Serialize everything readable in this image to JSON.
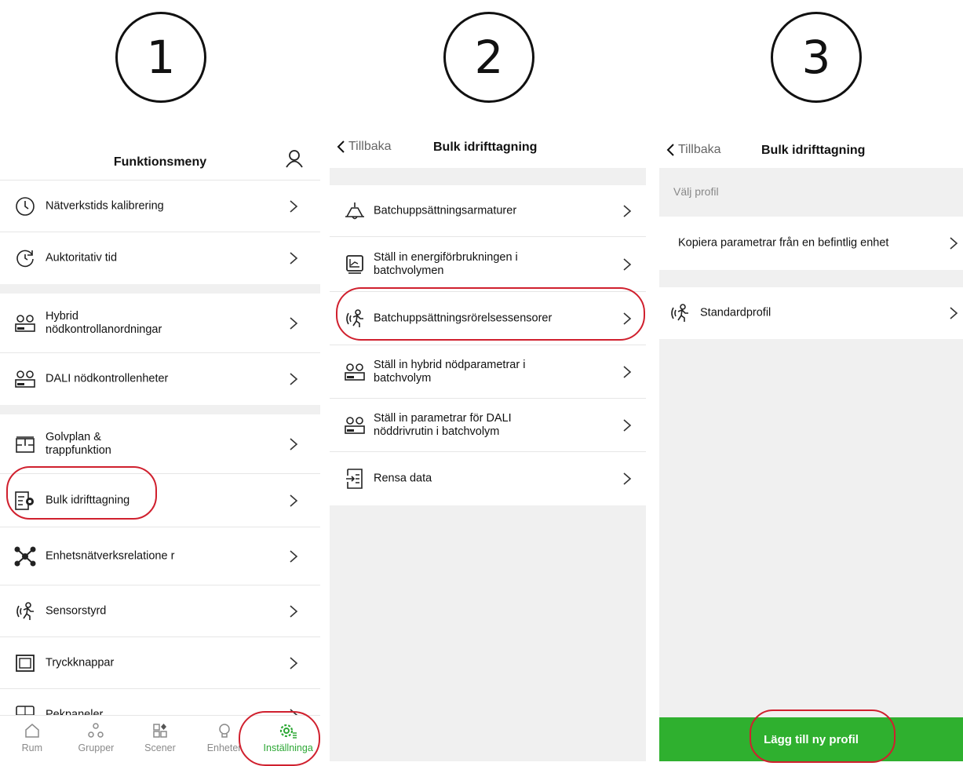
{
  "steps": [
    "1",
    "2",
    "3"
  ],
  "panel1": {
    "title": "Funktionsmeny",
    "items": [
      {
        "label": "Nätverkstids kalibrering",
        "icon": "clock-icon"
      },
      {
        "label": "Auktoritativ tid",
        "icon": "clock-sync-icon"
      },
      {
        "label": "Hybrid nödkontrollanordningar",
        "icon": "emergency-device-icon"
      },
      {
        "label": "DALI nödkontrollenheter",
        "icon": "emergency-device-icon"
      },
      {
        "label": "Golvplan & trappfunktion",
        "icon": "floorplan-icon"
      },
      {
        "label": "Bulk idrifttagning",
        "icon": "bulk-settings-icon"
      },
      {
        "label": "Enhetsnätverksrelatione r",
        "icon": "network-icon"
      },
      {
        "label": "Sensorstyrd",
        "icon": "motion-sensor-icon"
      },
      {
        "label": "Tryckknappar",
        "icon": "push-button-icon"
      },
      {
        "label": "Pekpaneler",
        "icon": "touch-panel-icon"
      }
    ],
    "tabs": [
      {
        "label": "Rum",
        "icon": "home-icon"
      },
      {
        "label": "Grupper",
        "icon": "groups-icon"
      },
      {
        "label": "Scener",
        "icon": "scenes-icon"
      },
      {
        "label": "Enheter",
        "icon": "bulb-icon"
      },
      {
        "label": "Inställninga",
        "icon": "settings-gear-icon"
      }
    ],
    "active_tab_color": "#2ea836"
  },
  "panel2": {
    "back": "Tillbaka",
    "title": "Bulk idrifttagning",
    "items": [
      {
        "label": "Batchuppsättningsarmaturer",
        "icon": "ceiling-lamp-icon"
      },
      {
        "label": "Ställ in energiförbrukningen i batchvolymen",
        "icon": "energy-chart-icon"
      },
      {
        "label": "Batchuppsättningsrörelsessensorer",
        "icon": "motion-sensor-icon"
      },
      {
        "label": "Ställ in hybrid nödparametrar i batchvolym",
        "icon": "emergency-device-icon"
      },
      {
        "label": "Ställ in parametrar för DALI nöddrivrutin i batchvolym",
        "icon": "emergency-device-icon"
      },
      {
        "label": "Rensa data",
        "icon": "clear-data-icon"
      }
    ]
  },
  "panel3": {
    "back": "Tillbaka",
    "title": "Bulk idrifttagning",
    "section_label": "Välj profil",
    "copy_item": "Kopiera parametrar från en befintlig enhet",
    "profile_item": "Standardprofil",
    "add_button": "Lägg till ny profil",
    "button_color": "#2fb02f"
  },
  "highlight_color": "#d0202e"
}
